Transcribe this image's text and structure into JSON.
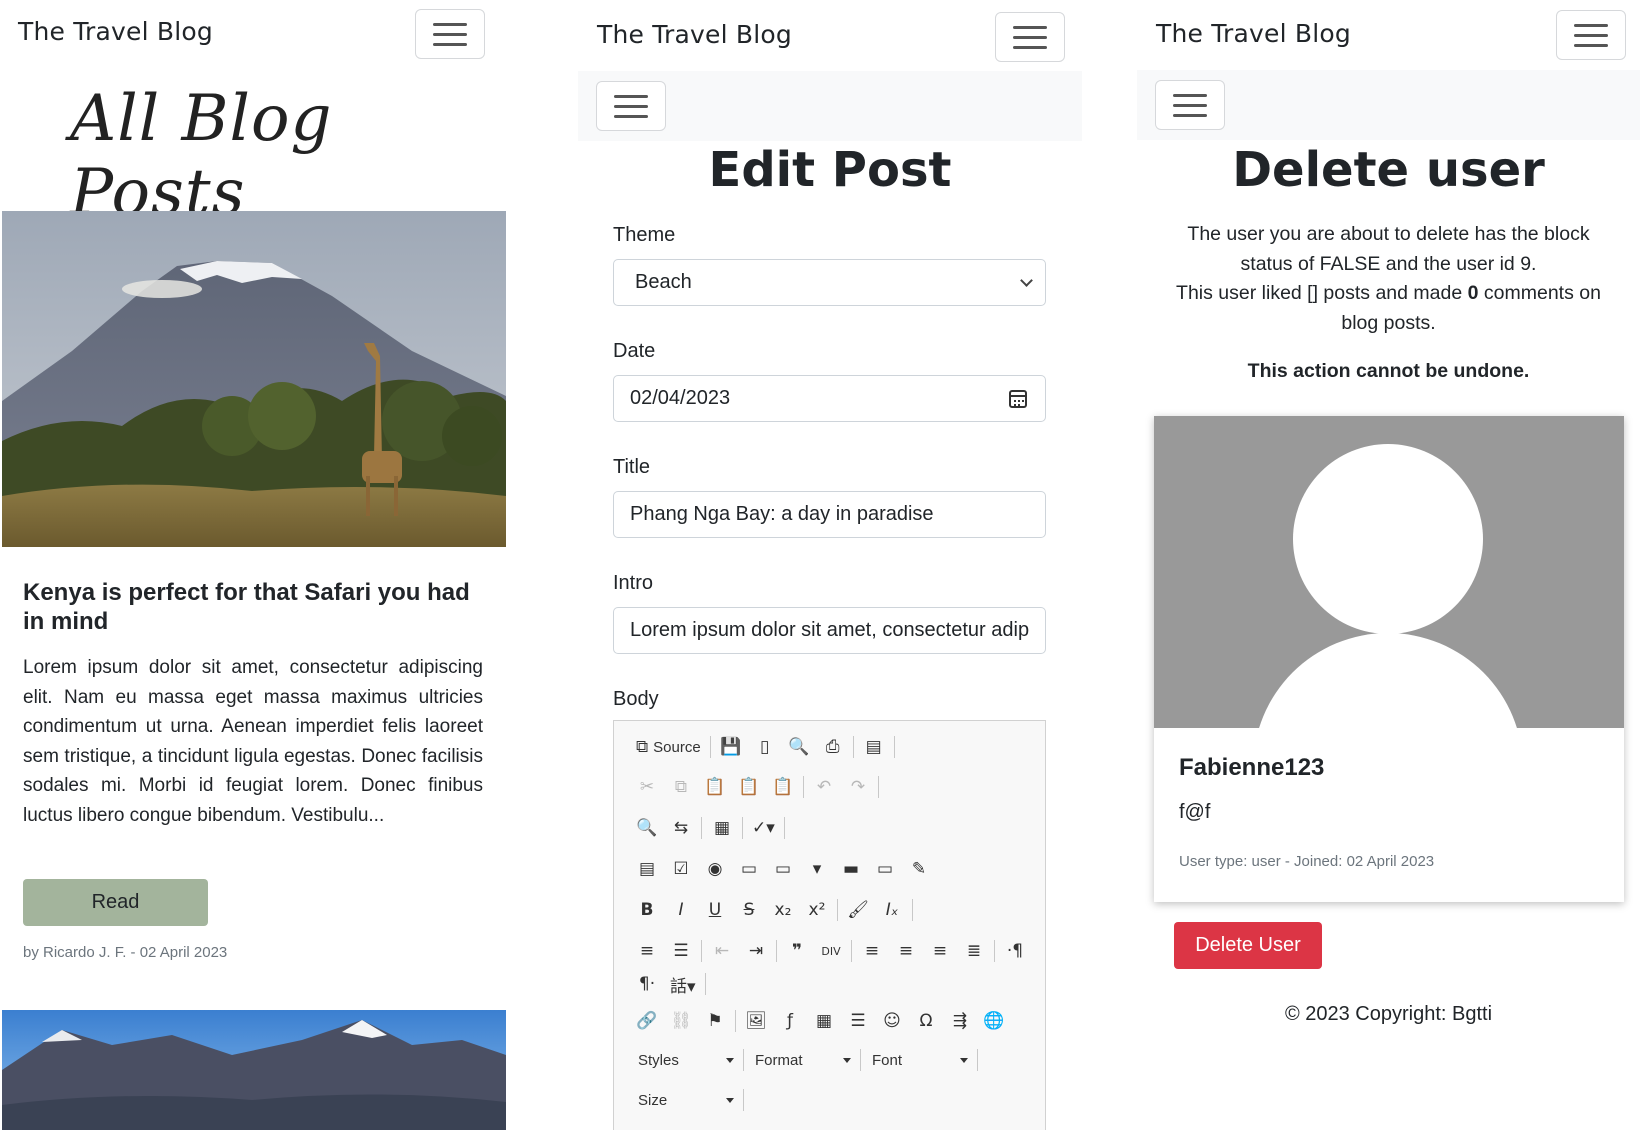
{
  "panel1": {
    "brand": "The Travel Blog",
    "heading": "All Blog Posts",
    "post": {
      "title": "Kenya is perfect for that Safari you had in mind",
      "excerpt": "Lorem ipsum dolor sit amet, consectetur adipiscing elit. Nam eu massa eget massa maximus ultricies condimentum ut urna. Aenean imperdiet felis laoreet sem tristique, a tincidunt ligula egestas. Donec facilisis sodales mi. Morbi id feugiat lorem. Donec finibus luctus libero congue bibendum. Vestibulu...",
      "button": "Read",
      "byline": "by Ricardo J. F. - 02 April 2023"
    }
  },
  "panel2": {
    "brand": "The Travel Blog",
    "heading": "Edit Post",
    "theme": {
      "label": "Theme",
      "value": "Beach"
    },
    "date": {
      "label": "Date",
      "value": "02/04/2023"
    },
    "title": {
      "label": "Title",
      "value": "Phang Nga Bay: a day in paradise"
    },
    "intro": {
      "label": "Intro",
      "value": "Lorem ipsum dolor sit amet, consectetur adipiscing"
    },
    "body": {
      "label": "Body"
    },
    "editor": {
      "source_label": "Source",
      "styles_label": "Styles",
      "format_label": "Format",
      "font_label": "Font",
      "size_label": "Size"
    }
  },
  "panel3": {
    "brand": "The Travel Blog",
    "heading": "Delete user",
    "line1": "The user you are about to delete has the block status of FALSE and the user id 9.",
    "line2_a": "This user liked [] posts and made ",
    "line2_count": "0",
    "line2_b": " comments on blog posts.",
    "warning": "This action cannot be undone.",
    "username": "Fabienne123",
    "email": "f@f",
    "meta": "User type: user - Joined: 02 April 2023",
    "delete_button": "Delete User",
    "footer": "© 2023 Copyright: Bgtti"
  },
  "colors": {
    "read_button": "#a3b49c",
    "delete_button": "#dc3545",
    "avatar_bg": "#999999",
    "subnav_bg": "#f8f9fa"
  }
}
